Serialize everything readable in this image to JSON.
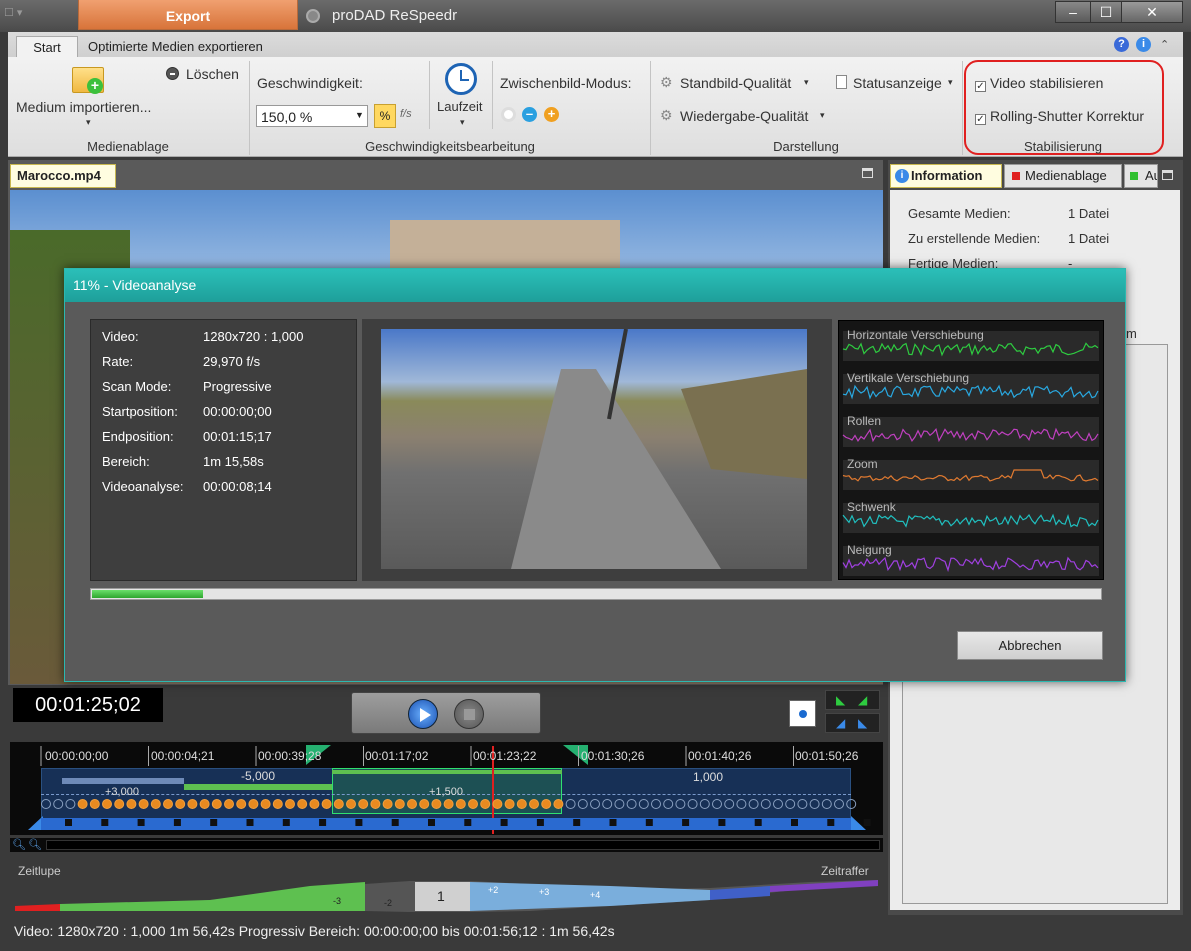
{
  "titlebar": {
    "export_tab": "Export",
    "app_title": "proDAD ReSpeedr"
  },
  "ribbon_tabs": {
    "start": "Start",
    "export_optimized": "Optimierte Medien exportieren"
  },
  "ribbon": {
    "import_label": "Medium importieren...",
    "delete_label": "Löschen",
    "group_media": "Medienablage",
    "speed_label": "Geschwindigkeit:",
    "speed_value": "150,0 %",
    "percent_btn": "%",
    "fps_btn": "f/s",
    "runtime_label": "Laufzeit",
    "group_speed": "Geschwindigkeitsbearbeitung",
    "interframe_label": "Zwischenbild-Modus:",
    "still_quality": "Standbild-Qualität",
    "playback_quality": "Wiedergabe-Qualität",
    "status_display": "Statusanzeige",
    "group_display": "Darstellung",
    "stabilize_video": "Video stabilisieren",
    "rolling_shutter": "Rolling-Shutter Korrektur",
    "group_stabilization": "Stabilisierung"
  },
  "video_tab": "Marocco.mp4",
  "right_tabs": {
    "information": "Information",
    "media": "Medienablage",
    "third": "Au"
  },
  "info": {
    "total_label": "Gesamte Medien:",
    "total_value": "1 Datei",
    "create_label": "Zu erstellende Medien:",
    "create_value": "1 Datei",
    "done_label": "Fertige Medien:",
    "done_value": "-",
    "partial": "m"
  },
  "dialog": {
    "title": "11% - Videoanalyse",
    "progress": 0.11,
    "stats": [
      {
        "label": "Video:",
        "value": "1280x720 : 1,000"
      },
      {
        "label": "Rate:",
        "value": "29,970 f/s"
      },
      {
        "label": "Scan Mode:",
        "value": "Progressive"
      },
      {
        "label": "Startposition:",
        "value": "00:00:00;00"
      },
      {
        "label": "Endposition:",
        "value": "00:01:15;17"
      },
      {
        "label": "Bereich:",
        "value": "1m 15,58s"
      },
      {
        "label": "Videoanalyse:",
        "value": "00:00:08;14"
      }
    ],
    "graphs": [
      {
        "label": "Horizontale Verschiebung",
        "color": "#2ecc40"
      },
      {
        "label": "Vertikale Verschiebung",
        "color": "#29a8e0"
      },
      {
        "label": "Rollen",
        "color": "#c040c0"
      },
      {
        "label": "Zoom",
        "color": "#e07a30"
      },
      {
        "label": "Schwenk",
        "color": "#20c0c0"
      },
      {
        "label": "Neigung",
        "color": "#a040e0"
      }
    ],
    "cancel": "Abbrechen"
  },
  "time_display": "00:01:25;02",
  "timeline": {
    "timecodes": [
      "00:00:00;00",
      "00:00:04;21",
      "00:00:39;28",
      "00:01:17;02",
      "00:01:23;22",
      "00:01:30;26",
      "00:01:40;26",
      "00:01:50;26"
    ],
    "speed_labels": [
      "-5,000",
      "+3,000",
      "+1,500",
      "1,000"
    ]
  },
  "speed_scale": {
    "slow": "Zeitlupe",
    "fast": "Zeitraffer",
    "center": "1",
    "neg": [
      "-3",
      "-2"
    ],
    "pos": [
      "+2",
      "+3",
      "+4"
    ]
  },
  "statusbar": "Video: 1280x720 : 1,000   1m 56,42s   Progressiv   Bereich: 00:00:00;00 bis 00:01:56;12 : 1m 56,42s"
}
